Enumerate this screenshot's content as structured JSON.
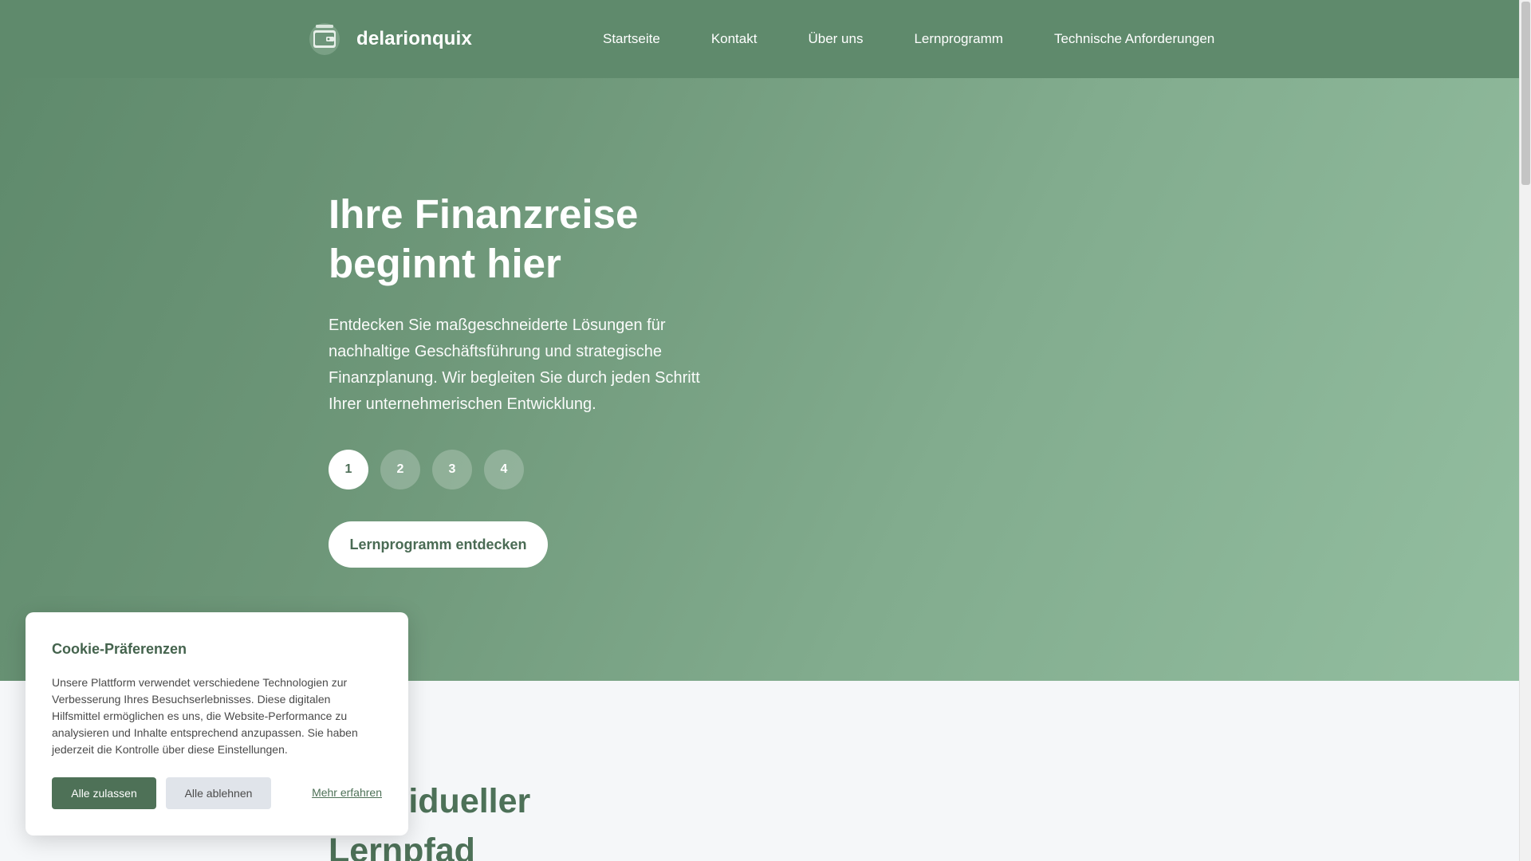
{
  "header": {
    "brand_name": "delarionquix",
    "logo_icon": "wallet-icon",
    "nav": [
      {
        "label": "Startseite"
      },
      {
        "label": "Kontakt"
      },
      {
        "label": "Über uns"
      },
      {
        "label": "Lernprogramm"
      },
      {
        "label": "Technische Anforderungen"
      }
    ]
  },
  "hero": {
    "title": "Ihre Finanzreise beginnt hier",
    "description": "Entdecken Sie maßgeschneiderte Lösungen für nachhaltige Geschäftsführung und strategische Finanzplanung. Wir begleiten Sie durch jeden Schritt Ihrer unternehmerischen Entwicklung.",
    "steps": [
      "1",
      "2",
      "3",
      "4"
    ],
    "active_step": "1",
    "cta_label": "Lernprogramm entdecken"
  },
  "section2": {
    "title": "Individueller Lernpfad"
  },
  "cookie_banner": {
    "title": "Cookie-Präferenzen",
    "text": "Unsere Plattform verwendet verschiedene Technologien zur Verbesserung Ihres Besuchserlebnisses. Diese digitalen Hilfsmittel ermöglichen es uns, die Website-Performance zu analysieren und Inhalte entsprechend anzupassen. Sie haben jederzeit die Kontrolle über diese Einstellungen.",
    "accept_label": "Alle zulassen",
    "decline_label": "Alle ablehnen",
    "more_label": "Mehr erfahren"
  },
  "colors": {
    "header_bg": "#5f8a6c",
    "hero_gradient_start": "#5f8a6c",
    "hero_gradient_end": "#93bea0",
    "accent_dark": "#4e7157",
    "page_bg": "#f5f7f9"
  }
}
